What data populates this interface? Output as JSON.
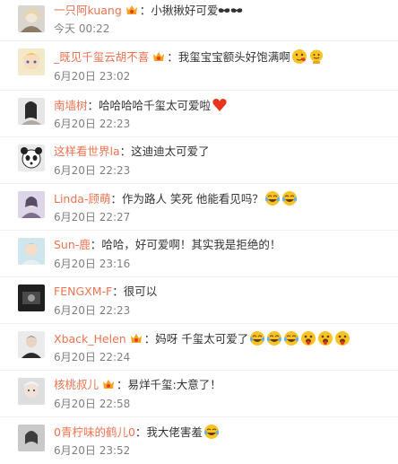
{
  "comments": [
    {
      "user": "一只阿kuang",
      "text": "小揪揪好可爱",
      "time": "今天 00:22",
      "badge": true,
      "emojis": [
        "mustache-icon"
      ]
    },
    {
      "user": "_既见千玺云胡不喜",
      "text": "我玺宝宝额头好饱满啊",
      "time": "6月20日 23:02",
      "badge": true,
      "emojis": [
        "kiss-face-icon",
        "smile-face-icon"
      ]
    },
    {
      "user": "南墙树",
      "text": "哈哈哈哈千玺太可爱啦",
      "time": "6月20日 22:23",
      "badge": false,
      "emojis": [
        "heart-icon"
      ]
    },
    {
      "user": "这样看世界la",
      "text": "这迪迪太可爱了",
      "time": "6月20日 22:23",
      "badge": false,
      "emojis": []
    },
    {
      "user": "Linda-顾萌",
      "text": "作为路人 笑死  他能看见吗？",
      "time": "6月20日 22:27",
      "badge": false,
      "emojis": [
        "laugh-cry-icon",
        "laugh-cry-icon"
      ]
    },
    {
      "user": "Sun-鹿",
      "text": "哈哈，好可爱啊！其实我是拒绝的！",
      "time": "6月20日 23:16",
      "badge": false,
      "emojis": []
    },
    {
      "user": "FENGXM-F",
      "text": "很可以",
      "time": "6月20日 22:23",
      "badge": false,
      "emojis": []
    },
    {
      "user": "Xback_Helen",
      "text": "妈呀 千玺太可爱了",
      "time": "6月20日 22:24",
      "badge": true,
      "emojis": [
        "laugh-cry-icon",
        "laugh-cry-icon",
        "laugh-cry-icon",
        "tongue-face-icon",
        "tongue-face-icon",
        "tongue-face-icon"
      ]
    },
    {
      "user": "核桃叔儿",
      "text": "易烊千玺:大意了！",
      "time": "6月20日 22:58",
      "badge": true,
      "emojis": []
    },
    {
      "user": "0青柠味的鹤儿0",
      "text": "我大佬害羞",
      "time": "6月20日 23:52",
      "badge": false,
      "emojis": [
        "laugh-cry-icon"
      ]
    }
  ],
  "colon": "："
}
